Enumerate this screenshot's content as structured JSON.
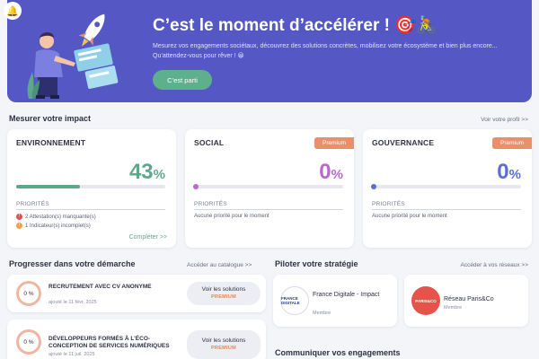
{
  "hero": {
    "title": "C’est le moment d’accélérer ! 🎯🚴",
    "text": "Mesurez vos engagements sociétaux, découvrez des solutions concrètes, mobilisez votre écosystème et bien plus encore... Qu’attendez-vous pour rêver ! 😀",
    "cta": "C’est parti"
  },
  "impact": {
    "title": "Mesurer votre impact",
    "link": "Voir votre profil >>",
    "cards": [
      {
        "name": "ENVIRONNEMENT",
        "value": "43",
        "unit": "%",
        "progress": 0.43,
        "color": "#5ea88a",
        "priorities_label": "PRIORITÉS",
        "priorities": [
          "2 Attestation(s) manquante(s)",
          "1 Indicateur(s) incomplet(s)"
        ],
        "complete": "Compléter >>"
      },
      {
        "name": "SOCIAL",
        "badge": "Premium",
        "value": "0",
        "unit": "%",
        "progress": 0.0,
        "color": "#b76bc6",
        "priorities_label": "PRIORITÉS",
        "priorities": [
          "Aucune priorité pour le moment"
        ]
      },
      {
        "name": "GOUVERNANCE",
        "badge": "Premium",
        "value": "0",
        "unit": "%",
        "progress": 0.0,
        "color": "#5a6fcf",
        "priorities_label": "PRIORITÉS",
        "priorities": [
          "Aucune priorité pour le moment"
        ]
      }
    ]
  },
  "progress": {
    "title": "Progresser dans votre démarche",
    "link": "Accéder au catalogue >>",
    "steps": [
      {
        "ring": "0 %",
        "title": "RECRUTEMENT AVEC CV ANONYME",
        "meta": "ajouté le 11 févr. 2025",
        "btn": "Voir les solutions",
        "premium": "PREMIUM"
      },
      {
        "ring": "0 %",
        "title": "DÉVELOPPEURS FORMÉS À L’ÉCO-CONCEPTION DE SERVICES NUMÉRIQUES",
        "meta": "ajouté le 11 juil. 2025",
        "btn": "Voir les solutions",
        "premium": "PREMIUM"
      }
    ]
  },
  "strategy": {
    "title": "Piloter votre stratégie",
    "link": "Accéder à vos réseaux >>",
    "networks": [
      {
        "name": "France Digitale - Impact",
        "role": "Membre",
        "logo": "FRANCE DIGITALE",
        "logo_bg": "#ffffff",
        "logo_color": "#2b3a8c"
      },
      {
        "name": "Réseau Paris&Co",
        "role": "Membre",
        "logo": "PARIS&CO",
        "logo_bg": "#e5534b",
        "logo_color": "#ffffff"
      }
    ]
  },
  "communicate": {
    "title": "Communiquer vos engagements"
  },
  "icons": {
    "bell": "bell-icon",
    "warning": "warning-icon",
    "info": "info-icon"
  }
}
